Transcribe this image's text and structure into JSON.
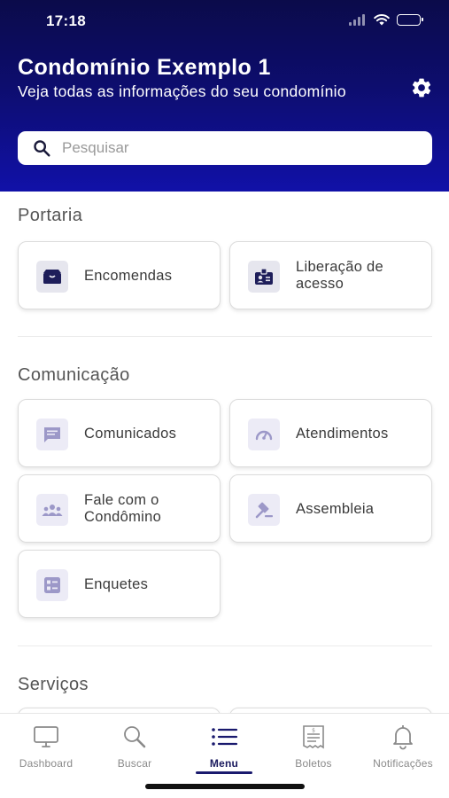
{
  "status": {
    "time": "17:18"
  },
  "header": {
    "title": "Condomínio Exemplo 1",
    "subtitle": "Veja todas as informações do seu condomínio"
  },
  "search": {
    "placeholder": "Pesquisar",
    "value": ""
  },
  "sections": {
    "portaria": {
      "title": "Portaria",
      "encomendas": "Encomendas",
      "liberacao": "Liberação de acesso"
    },
    "comunicacao": {
      "title": "Comunicação",
      "comunicados": "Comunicados",
      "atendimentos": "Atendimentos",
      "fale": "Fale com o Condômino",
      "assembleia": "Assembleia",
      "enquetes": "Enquetes"
    },
    "servicos": {
      "title": "Serviços"
    }
  },
  "tabs": {
    "dashboard": "Dashboard",
    "buscar": "Buscar",
    "menu": "Menu",
    "boletos": "Boletos",
    "notificacoes": "Notificações",
    "active": "menu"
  },
  "icons": {
    "encomendas": "package-icon",
    "liberacao": "id-badge-icon",
    "comunicados": "message-icon",
    "atendimentos": "speedometer-icon",
    "fale": "group-icon",
    "assembleia": "gavel-icon",
    "enquetes": "poll-icon",
    "settings": "gear-icon"
  },
  "colors": {
    "header_top": "#0b0b4a",
    "header_bottom": "#1111a8",
    "accent": "#1a1a6e",
    "icon_dark": "#1e1e5a",
    "icon_light": "#9c98c8"
  }
}
